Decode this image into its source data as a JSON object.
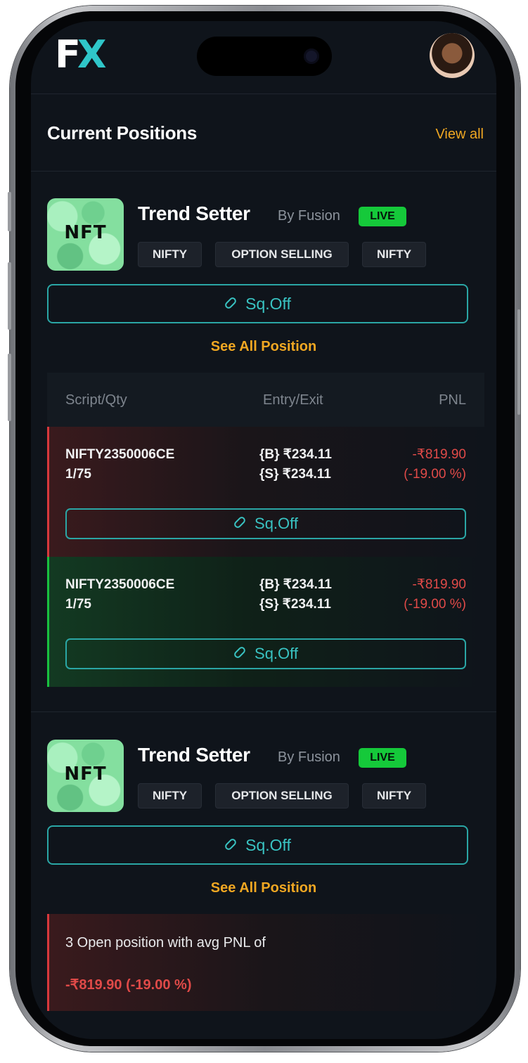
{
  "app": {
    "logo_f": "F",
    "logo_x": "X"
  },
  "section": {
    "title": "Current Positions",
    "view_all": "View all"
  },
  "strategies": [
    {
      "thumb_text": "NFT",
      "name": "Trend Setter",
      "by": "By Fusion",
      "status": "LIVE",
      "tags": [
        "NIFTY",
        "OPTION SELLING",
        "NIFTY"
      ],
      "sqoff_label": "Sq.Off",
      "see_all": "See All Position"
    },
    {
      "thumb_text": "NFT",
      "name": "Trend Setter",
      "by": "By Fusion",
      "status": "LIVE",
      "tags": [
        "NIFTY",
        "OPTION SELLING",
        "NIFTY"
      ],
      "sqoff_label": "Sq.Off",
      "see_all": "See All Position"
    }
  ],
  "positions_table": {
    "headers": [
      "Script/Qty",
      "Entry/Exit",
      "PNL"
    ],
    "rows": [
      {
        "script": "NIFTY2350006CE",
        "qty": "1/75",
        "entry": "{B} ₹234.11",
        "exit": "{S} ₹234.11",
        "pnl": "-₹819.90",
        "pnl_pct": "(-19.00 %)",
        "sqoff_label": "Sq.Off",
        "status": "loss"
      },
      {
        "script": "NIFTY2350006CE",
        "qty": "1/75",
        "entry": "{B} ₹234.11",
        "exit": "{S} ₹234.11",
        "pnl": "-₹819.90",
        "pnl_pct": "(-19.00 %)",
        "sqoff_label": "Sq.Off",
        "status": "profit"
      }
    ]
  },
  "summary": {
    "text": "3 Open position with avg PNL of",
    "value": "-₹819.90 (-19.00 %)"
  },
  "colors": {
    "background": "#0f141b",
    "accent_teal": "#39c3c2",
    "accent_orange": "#f0a722",
    "live_green": "#15c93a",
    "loss_red": "#e04a48"
  }
}
